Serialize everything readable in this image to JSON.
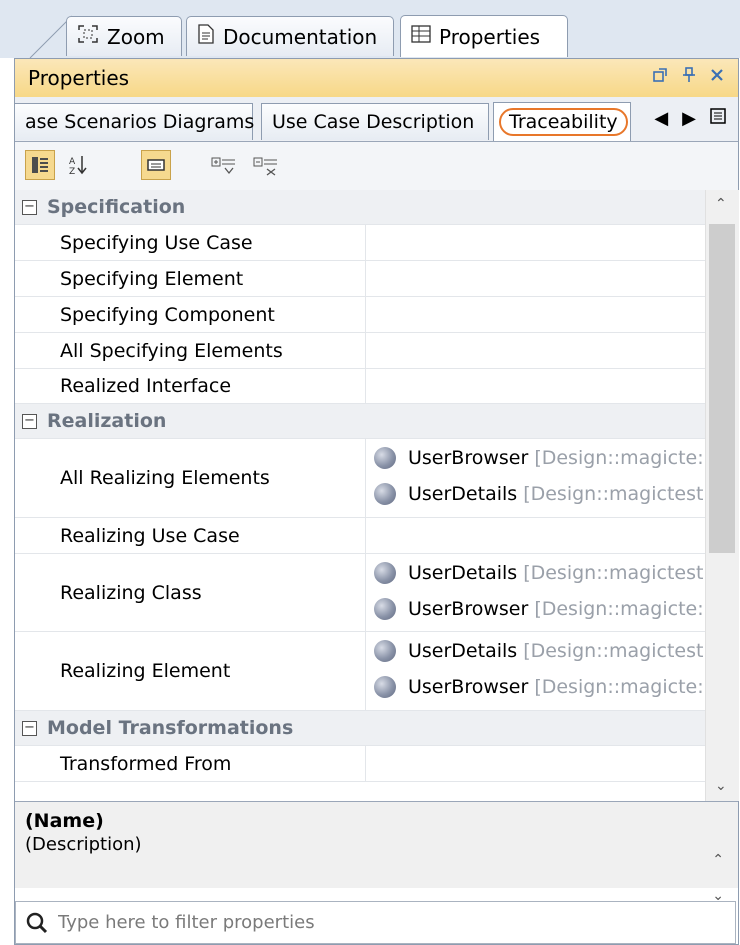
{
  "top_tabs": [
    {
      "label": "Zoom",
      "icon": "zoom-icon"
    },
    {
      "label": "Documentation",
      "icon": "document-icon"
    },
    {
      "label": "Properties",
      "icon": "properties-icon"
    }
  ],
  "panel": {
    "title": "Properties",
    "sub_tabs": [
      {
        "label": "ase Scenarios Diagrams"
      },
      {
        "label": "Use Case Description"
      },
      {
        "label": "Traceability"
      }
    ]
  },
  "grid": {
    "categories": [
      {
        "label": "Specification"
      },
      {
        "label": "Realization"
      },
      {
        "label": "Model Transformations"
      }
    ],
    "properties": [
      {
        "name": "Specifying Use Case",
        "values": []
      },
      {
        "name": "Specifying Element",
        "values": []
      },
      {
        "name": "Specifying Component",
        "values": []
      },
      {
        "name": "All Specifying Elements",
        "values": []
      },
      {
        "name": "Realized Interface",
        "values": []
      },
      {
        "name": "All Realizing Elements",
        "values": [
          {
            "name": "UserBrowser",
            "path": "[Design::magicte:"
          },
          {
            "name": "UserDetails",
            "path": "[Design::magictest"
          }
        ]
      },
      {
        "name": "Realizing Use Case",
        "values": []
      },
      {
        "name": "Realizing Class",
        "values": [
          {
            "name": "UserDetails",
            "path": "[Design::magictest"
          },
          {
            "name": "UserBrowser",
            "path": "[Design::magicte:"
          }
        ]
      },
      {
        "name": "Realizing Element",
        "values": [
          {
            "name": "UserDetails",
            "path": "[Design::magictest"
          },
          {
            "name": "UserBrowser",
            "path": "[Design::magicte:"
          }
        ]
      },
      {
        "name": "Transformed From",
        "values": []
      }
    ]
  },
  "description": {
    "name": "(Name)",
    "text": "(Description)"
  },
  "filter": {
    "placeholder": "Type here to filter properties"
  },
  "colors": {
    "title_bar": "#f7d887",
    "highlight": "#e8772a",
    "pressed_button": "#f6d98f"
  }
}
